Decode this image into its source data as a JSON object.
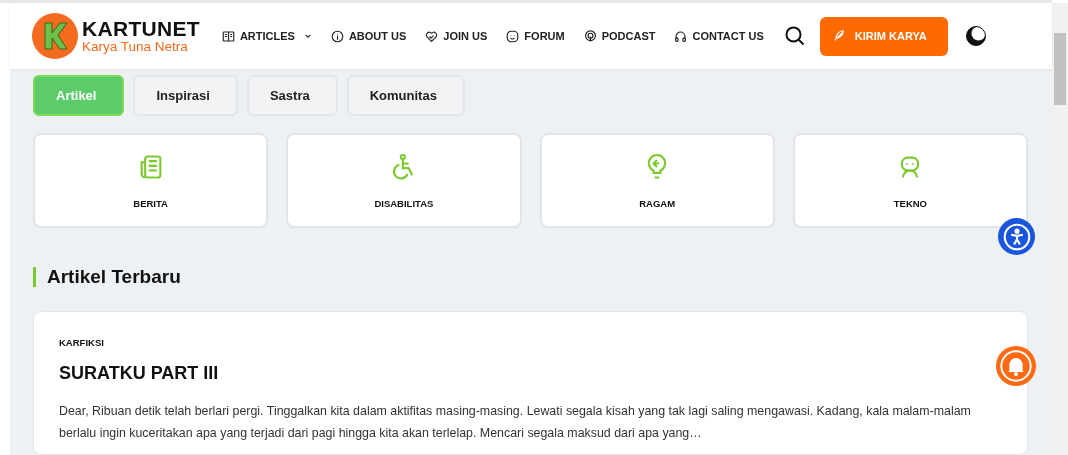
{
  "header": {
    "logo_title": "KARTUNET",
    "logo_subtitle": "Karya Tuna Netra",
    "nav": [
      {
        "kind": "articles",
        "label": "ARTICLES",
        "dropdown": true
      },
      {
        "kind": "about",
        "label": "ABOUT US",
        "dropdown": false
      },
      {
        "kind": "join",
        "label": "JOIN US",
        "dropdown": false
      },
      {
        "kind": "forum",
        "label": "FORUM",
        "dropdown": false
      },
      {
        "kind": "podcast",
        "label": "PODCAST",
        "dropdown": false
      },
      {
        "kind": "contact",
        "label": "CONTACT US",
        "dropdown": false
      }
    ],
    "submit_button": "KIRIM KARYA"
  },
  "tabs": [
    {
      "label": "Artikel",
      "selected": true
    },
    {
      "label": "Inspirasi",
      "selected": false
    },
    {
      "label": "Sastra",
      "selected": false
    },
    {
      "label": "Komunitas",
      "selected": false
    }
  ],
  "categories": [
    {
      "kind": "news",
      "label": "BERITA"
    },
    {
      "kind": "wheelchair",
      "label": "DISABILITAS"
    },
    {
      "kind": "bulb",
      "label": "RAGAM"
    },
    {
      "kind": "robot",
      "label": "TEKNO"
    }
  ],
  "latest": {
    "heading": "Artikel Terbaru",
    "article": {
      "category": "KARFIKSI",
      "title": "SURATKU PART III",
      "excerpt": "Dear, Ribuan detik telah berlari pergi. Tinggalkan kita dalam aktifitas masing-masing. Lewati segala kisah yang tak lagi saling mengawasi. Kadang, kala malam-malam berlalu ingin kuceritakan apa yang terjadi dari pagi hingga kita akan terlelap. Mencari segala maksud dari apa yang…"
    }
  }
}
